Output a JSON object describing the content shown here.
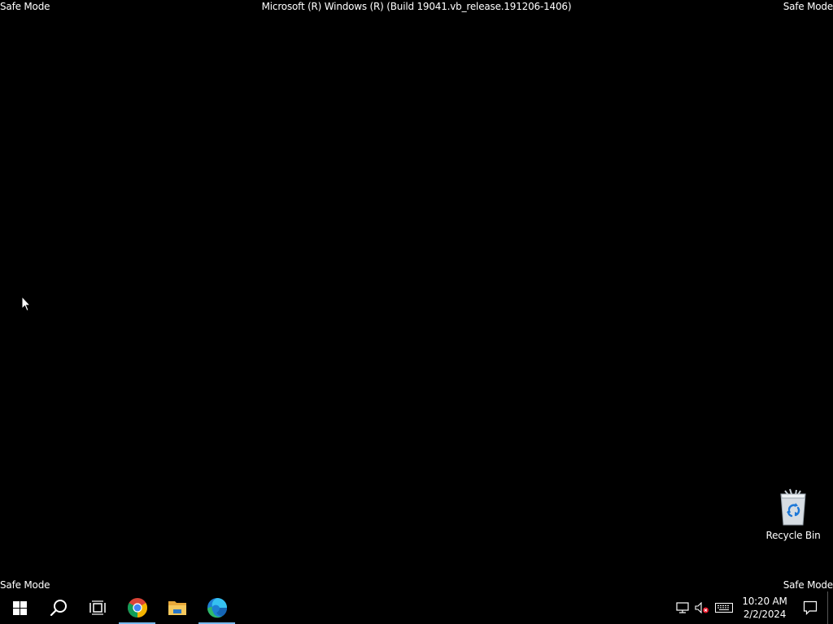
{
  "watermark": {
    "top_left": "Safe Mode",
    "top_right": "Safe Mode",
    "bottom_left": "Safe Mode",
    "bottom_right": "Safe Mode",
    "build": "Microsoft (R) Windows (R) (Build 19041.vb_release.191206-1406)"
  },
  "desktop": {
    "icons": [
      {
        "label": "Recycle Bin",
        "icon": "recycle-bin-icon"
      }
    ]
  },
  "taskbar": {
    "buttons": [
      {
        "name": "start",
        "icon": "windows-logo-icon"
      },
      {
        "name": "search",
        "icon": "search-icon"
      },
      {
        "name": "task-view",
        "icon": "task-view-icon"
      },
      {
        "name": "chrome",
        "icon": "chrome-icon",
        "running": true
      },
      {
        "name": "file-explorer",
        "icon": "folder-icon",
        "running": false
      },
      {
        "name": "edge",
        "icon": "edge-icon",
        "running": true
      }
    ],
    "tray": {
      "icons": [
        "network-icon",
        "volume-muted-icon",
        "keyboard-icon"
      ],
      "time": "10:20 AM",
      "date": "2/2/2024"
    },
    "accent_color": "#76b9ed"
  }
}
